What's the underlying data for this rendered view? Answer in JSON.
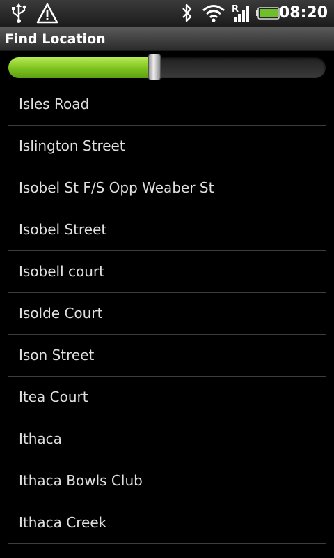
{
  "status_bar": {
    "time": "08:20",
    "icons": [
      "usb-icon",
      "warning-icon",
      "bluetooth-icon",
      "wifi-icon",
      "roaming-signal-icon",
      "battery-icon"
    ],
    "roaming_label": "R",
    "battery_color": "#6fbf2a"
  },
  "title_bar": {
    "title": "Find Location"
  },
  "slider": {
    "value_percent": 46,
    "fill_color": "#8ccd2a"
  },
  "locations": [
    "Isles Road",
    "Islington Street",
    "Isobel St F/S Opp Weaber St",
    "Isobel Street",
    "Isobell court",
    "Isolde Court",
    "Ison Street",
    "Itea Court",
    "Ithaca",
    "Ithaca Bowls Club",
    "Ithaca Creek"
  ]
}
